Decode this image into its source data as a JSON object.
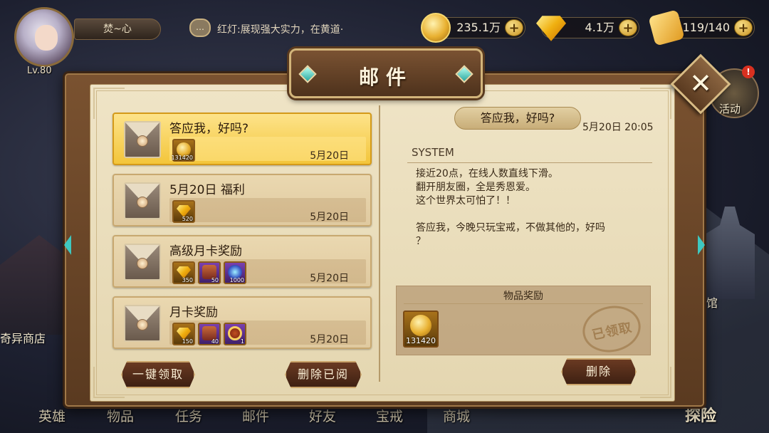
{
  "player": {
    "name": "焚~心",
    "level": "Lv.80"
  },
  "chat": {
    "text": "红灯:展现强大实力，在黄道·"
  },
  "resources": {
    "gold": "235.1万",
    "gems": "4.1万",
    "stamina": "119/140"
  },
  "side_labels": {
    "event": "活动",
    "hall": "馆",
    "shop": "奇异商店"
  },
  "bottom_nav": [
    "英雄",
    "物品",
    "任务",
    "邮件",
    "好友",
    "宝戒",
    "商城"
  ],
  "explore_label": "探险",
  "mail_window": {
    "title": "邮件",
    "close_label": "✕",
    "buttons": {
      "claim_all": "一键领取",
      "delete_read": "删除已阅",
      "delete": "删除"
    },
    "mails": [
      {
        "title": "答应我，好吗?",
        "date": "5月20日",
        "selected": true,
        "rewards": [
          {
            "icon": "coin",
            "qty": "131420",
            "frame": "gold"
          }
        ]
      },
      {
        "title": "5月20日 福利",
        "date": "5月20日",
        "rewards": [
          {
            "icon": "gem",
            "qty": "520",
            "frame": "gold"
          }
        ]
      },
      {
        "title": "高级月卡奖励",
        "date": "5月20日",
        "rewards": [
          {
            "icon": "gem",
            "qty": "350",
            "frame": "gold"
          },
          {
            "icon": "chest",
            "qty": "50",
            "frame": "purple"
          },
          {
            "icon": "orb",
            "qty": "1000",
            "frame": "purple"
          }
        ]
      },
      {
        "title": "月卡奖励",
        "date": "5月20日",
        "rewards": [
          {
            "icon": "gem",
            "qty": "150",
            "frame": "gold"
          },
          {
            "icon": "chest",
            "qty": "40",
            "frame": "purple"
          },
          {
            "icon": "coin-ring",
            "qty": "1",
            "frame": "purple"
          }
        ]
      }
    ],
    "detail": {
      "title": "答应我，好吗?",
      "time": "5月20日 20:05",
      "sender": "SYSTEM",
      "body_lines": [
        "接近20点，在线人数直线下滑。",
        "翻开朋友圈，全是秀恩爱。",
        "这个世界太可怕了！！",
        "",
        "答应我，今晚只玩宝戒，不做其他的，好吗",
        "？"
      ],
      "reward_title": "物品奖励",
      "reward": {
        "icon": "coin",
        "qty": "131420"
      },
      "stamp": "已领取"
    }
  },
  "colors": {
    "accent_gold": "#f3c53a",
    "paper": "#efe4c6",
    "frame_brown": "#5a3a20"
  }
}
